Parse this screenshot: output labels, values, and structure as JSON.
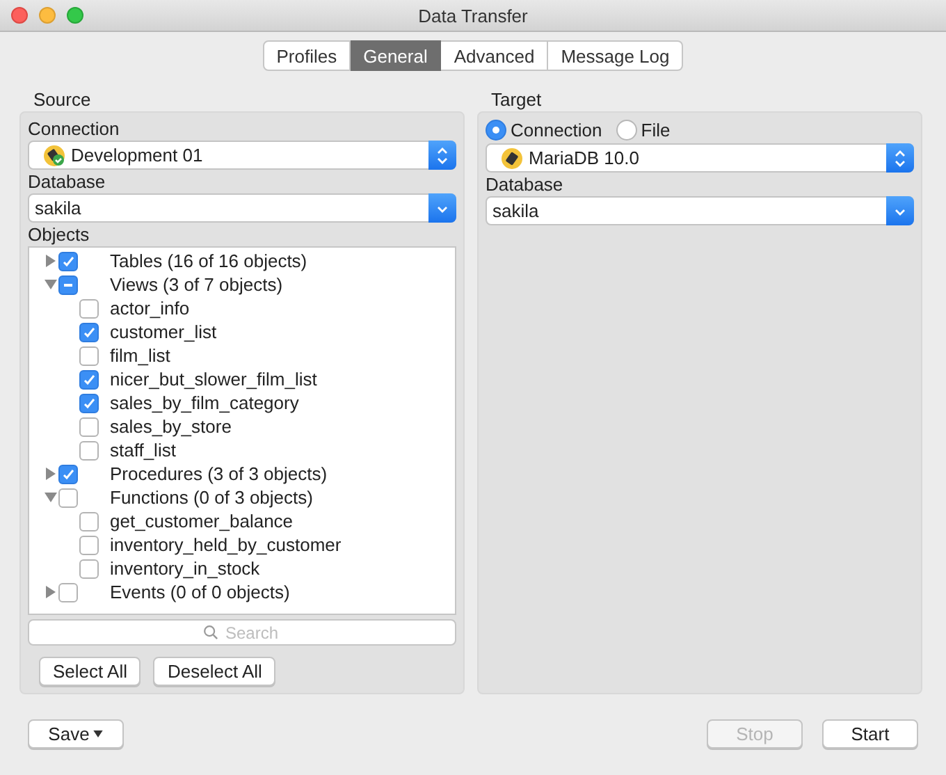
{
  "window": {
    "title": "Data Transfer"
  },
  "tabs": [
    {
      "label": "Profiles",
      "selected": false
    },
    {
      "label": "General",
      "selected": true
    },
    {
      "label": "Advanced",
      "selected": false
    },
    {
      "label": "Message Log",
      "selected": false
    }
  ],
  "source": {
    "title": "Source",
    "connection_label": "Connection",
    "connection": "Development 01",
    "database_label": "Database",
    "database": "sakila",
    "objects_label": "Objects",
    "objects": [
      {
        "label": "Tables (16 of 16 objects)",
        "checked": true,
        "mixed": false,
        "expanded": false
      },
      {
        "label": "Views (3 of 7 objects)",
        "checked": true,
        "mixed": true,
        "expanded": true,
        "children": [
          {
            "label": "actor_info",
            "checked": false
          },
          {
            "label": "customer_list",
            "checked": true
          },
          {
            "label": "film_list",
            "checked": false
          },
          {
            "label": "nicer_but_slower_film_list",
            "checked": true
          },
          {
            "label": "sales_by_film_category",
            "checked": true
          },
          {
            "label": "sales_by_store",
            "checked": false
          },
          {
            "label": "staff_list",
            "checked": false
          }
        ]
      },
      {
        "label": "Procedures (3 of 3 objects)",
        "checked": true,
        "mixed": false,
        "expanded": false
      },
      {
        "label": "Functions (0 of 3 objects)",
        "checked": false,
        "mixed": false,
        "expanded": true,
        "children": [
          {
            "label": "get_customer_balance",
            "checked": false
          },
          {
            "label": "inventory_held_by_customer",
            "checked": false
          },
          {
            "label": "inventory_in_stock",
            "checked": false
          }
        ]
      },
      {
        "label": "Events (0 of 0 objects)",
        "checked": false,
        "mixed": false,
        "expanded": false
      }
    ],
    "search": {
      "placeholder": "Search"
    },
    "buttons": [
      "Select All",
      "Deselect All"
    ]
  },
  "target": {
    "title": "Target",
    "modes": [
      {
        "label": "Connection",
        "selected": true
      },
      {
        "label": "File",
        "selected": false
      }
    ],
    "connection": "MariaDB 10.0",
    "database_label": "Database",
    "database": "sakila"
  },
  "footer": {
    "save": "Save",
    "stop": {
      "label": "Stop",
      "disabled": true
    },
    "start": {
      "label": "Start",
      "disabled": false
    }
  }
}
